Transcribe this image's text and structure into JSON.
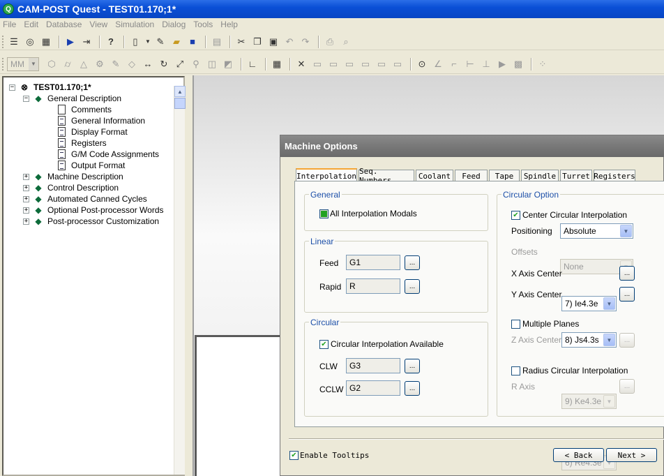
{
  "window": {
    "title": "CAM-POST Quest - TEST01.170;1*",
    "app_icon": "Q"
  },
  "menu": [
    "File",
    "Edit",
    "Database",
    "View",
    "Simulation",
    "Dialog",
    "Tools",
    "Help"
  ],
  "toolbar2": {
    "units": "MM"
  },
  "tree": {
    "root": "TEST01.170;1*",
    "nodes": [
      {
        "label": "General Description"
      },
      {
        "label": "Comments"
      },
      {
        "label": "General Information"
      },
      {
        "label": "Display Format"
      },
      {
        "label": "Registers"
      },
      {
        "label": "G/M Code Assignments"
      },
      {
        "label": "Output Format"
      },
      {
        "label": "Machine Description"
      },
      {
        "label": "Control Description"
      },
      {
        "label": "Automated Canned Cycles"
      },
      {
        "label": "Optional Post-processor Words"
      },
      {
        "label": "Post-processor Customization"
      }
    ]
  },
  "dialog": {
    "title": "Machine Options",
    "tabs": [
      "Interpolation",
      "Seq. Numbers",
      "Coolant",
      "Feed",
      "Tape",
      "Spindle",
      "Turret",
      "Registers"
    ],
    "general": {
      "group": "General",
      "all_modals": "All Interpolation Modals"
    },
    "linear": {
      "group": "Linear",
      "feed_label": "Feed",
      "feed_value": "G1",
      "rapid_label": "Rapid",
      "rapid_value": "R"
    },
    "circular": {
      "group": "Circular",
      "available": "Circular Interpolation Available",
      "clw_label": "CLW",
      "clw_value": "G3",
      "cclw_label": "CCLW",
      "cclw_value": "G2"
    },
    "circular_option": {
      "group": "Circular Option",
      "center": "Center Circular Interpolation",
      "positioning_label": "Positioning",
      "positioning_value": "Absolute",
      "offsets_label": "Offsets",
      "offsets_value": "None",
      "x_label": "X Axis Center",
      "x_value": "7) Ie4.3e",
      "y_label": "Y Axis Center",
      "y_value": "8) Js4.3s",
      "multiple_planes": "Multiple Planes",
      "z_label": "Z Axis Center",
      "z_value": "9) Ke4.3e",
      "radius": "Radius Circular Interpolation",
      "r_label": "R Axis",
      "r_value": "6) Re4.3e"
    },
    "ellipsis": "...",
    "enable_tooltips": "Enable Tooltips",
    "back": "< Back",
    "next": "Next >"
  },
  "colors": {
    "titlebar": "#0a4fd6",
    "dialog_title": "#787878",
    "group_label": "#1c4fa8",
    "check": "#21a121"
  }
}
